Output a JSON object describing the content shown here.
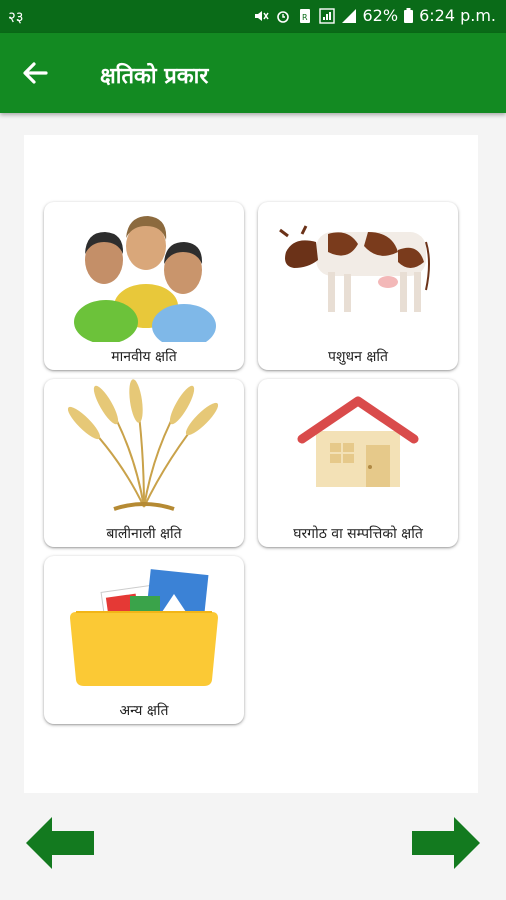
{
  "status_bar": {
    "left_text": "२३",
    "battery": "62%",
    "time": "6:24 p.m."
  },
  "app_bar": {
    "title": "क्षतिको प्रकार",
    "back_icon": "arrow-left-icon"
  },
  "tiles": [
    {
      "label": "मानवीय क्षति",
      "icon": "people-icon"
    },
    {
      "label": "पशुधन क्षति",
      "icon": "cow-icon"
    },
    {
      "label": "बालीनाली क्षति",
      "icon": "wheat-icon"
    },
    {
      "label": "घरगोठ वा सम्पत्तिको क्षति",
      "icon": "house-icon"
    },
    {
      "label": "अन्य क्षति",
      "icon": "folder-icon"
    }
  ],
  "navigation": {
    "prev_icon": "arrow-left-icon",
    "next_icon": "arrow-right-icon"
  },
  "colors": {
    "status_bar": "#0a6b18",
    "app_bar": "#138a22",
    "nav_arrow": "#137a1f"
  }
}
